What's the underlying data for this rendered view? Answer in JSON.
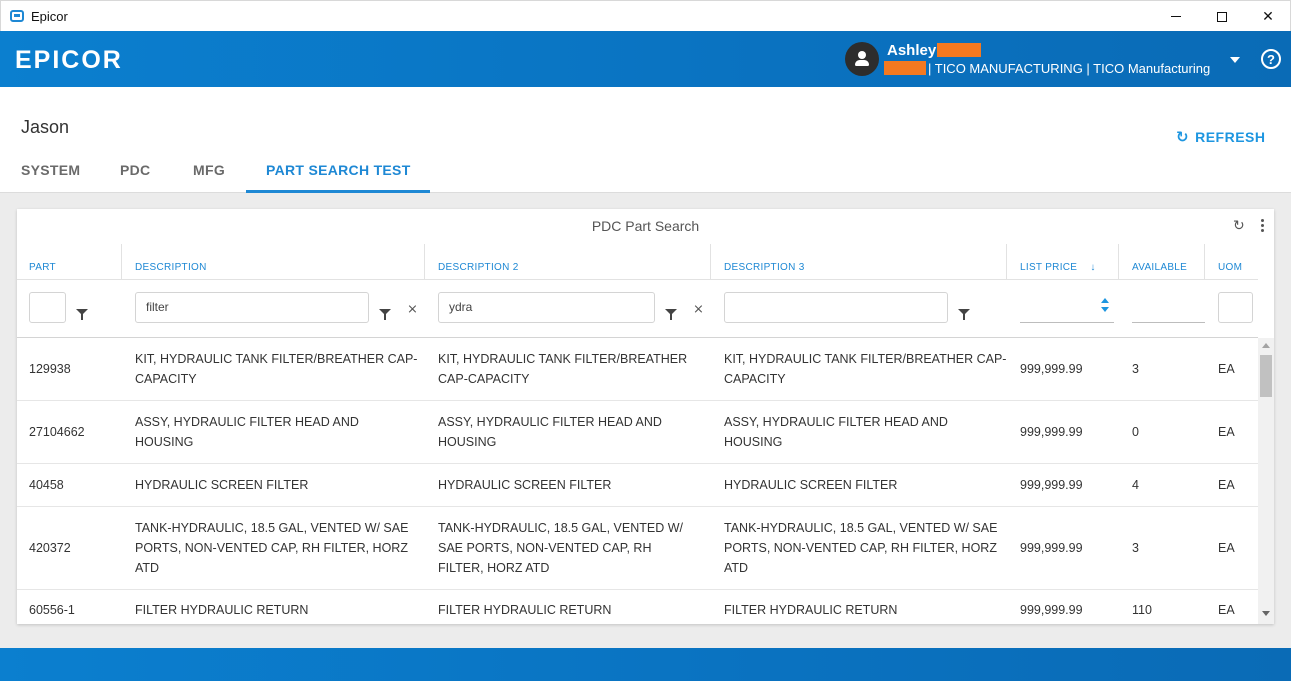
{
  "window": {
    "title": "Epicor"
  },
  "header": {
    "logo": "EPICOR",
    "user_name": "Ashley",
    "company_line": "| TICO MANUFACTURING  |  TICO Manufacturing",
    "redact_color": "#f47920"
  },
  "page": {
    "title": "Jason",
    "refresh_label": "REFRESH",
    "tabs": [
      {
        "label": "SYSTEM"
      },
      {
        "label": "PDC"
      },
      {
        "label": "MFG"
      },
      {
        "label": "PART SEARCH TEST",
        "active": true
      }
    ]
  },
  "grid": {
    "title": "PDC Part Search",
    "columns": [
      "PART",
      "DESCRIPTION",
      "DESCRIPTION 2",
      "DESCRIPTION 3",
      "LIST PRICE",
      "AVAILABLE",
      "UOM"
    ],
    "sort_indicator": "↓",
    "filters": {
      "part": "",
      "description": "filter",
      "description2": "ydra",
      "description3": ""
    },
    "rows": [
      {
        "part": "129938",
        "d1": "KIT, HYDRAULIC TANK FILTER/BREATHER CAP-CAPACITY",
        "d2": "KIT, HYDRAULIC TANK FILTER/BREATHER CAP-CAPACITY",
        "d3": "KIT, HYDRAULIC TANK FILTER/BREATHER CAP-CAPACITY",
        "price": "999,999.99",
        "available": "3",
        "uom": "EA"
      },
      {
        "part": "27104662",
        "d1": "ASSY, HYDRAULIC FILTER HEAD AND HOUSING",
        "d2": "ASSY, HYDRAULIC FILTER HEAD AND HOUSING",
        "d3": "ASSY, HYDRAULIC FILTER HEAD AND HOUSING",
        "price": "999,999.99",
        "available": "0",
        "uom": "EA"
      },
      {
        "part": "40458",
        "d1": "HYDRAULIC SCREEN FILTER",
        "d2": "HYDRAULIC SCREEN FILTER",
        "d3": "HYDRAULIC SCREEN FILTER",
        "price": "999,999.99",
        "available": "4",
        "uom": "EA"
      },
      {
        "part": "420372",
        "d1": "TANK-HYDRAULIC, 18.5 GAL, VENTED W/ SAE PORTS, NON-VENTED CAP, RH FILTER, HORZ ATD",
        "d2": "TANK-HYDRAULIC, 18.5 GAL, VENTED W/ SAE PORTS, NON-VENTED CAP, RH FILTER, HORZ ATD",
        "d3": "TANK-HYDRAULIC, 18.5 GAL, VENTED W/ SAE PORTS, NON-VENTED CAP, RH FILTER, HORZ ATD",
        "price": "999,999.99",
        "available": "3",
        "uom": "EA"
      },
      {
        "part": "60556-1",
        "d1": "FILTER HYDRAULIC RETURN",
        "d2": "FILTER HYDRAULIC RETURN",
        "d3": "FILTER HYDRAULIC RETURN",
        "price": "999,999.99",
        "available": "110",
        "uom": "EA"
      }
    ]
  }
}
